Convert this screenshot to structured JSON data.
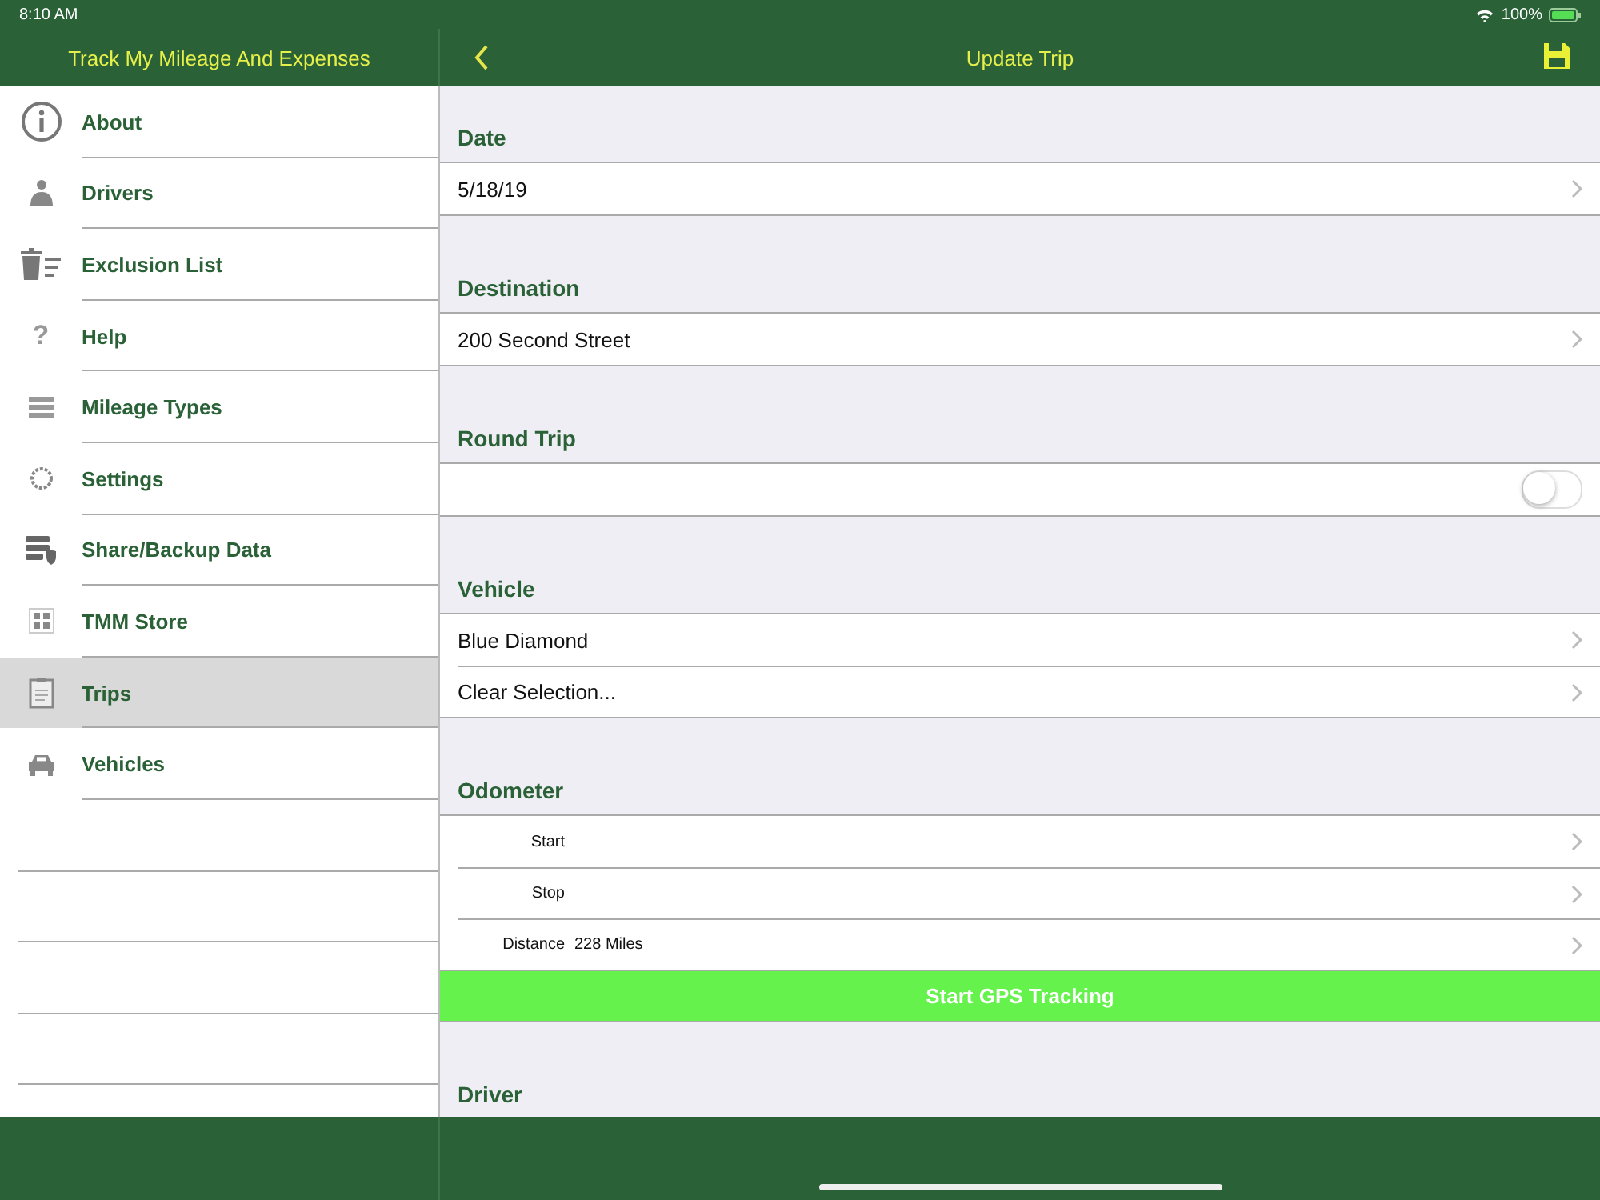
{
  "status_bar": {
    "time": "8:10 AM",
    "battery": "100%"
  },
  "sidebar": {
    "title": "Track My Mileage And Expenses",
    "items": [
      {
        "label": "About",
        "selected": false
      },
      {
        "label": "Drivers",
        "selected": false
      },
      {
        "label": "Exclusion List",
        "selected": false
      },
      {
        "label": "Help",
        "glyph": "?",
        "selected": false
      },
      {
        "label": "Mileage Types",
        "selected": false
      },
      {
        "label": "Settings",
        "selected": false
      },
      {
        "label": "Share/Backup Data",
        "selected": false
      },
      {
        "label": "TMM Store",
        "selected": false
      },
      {
        "label": "Trips",
        "selected": true
      },
      {
        "label": "Vehicles",
        "selected": false
      }
    ]
  },
  "nav": {
    "title": "Update Trip"
  },
  "sections": [
    {
      "title": "Date",
      "items": [
        {
          "kind": "link",
          "text": "5/18/19"
        }
      ]
    },
    {
      "title": "Destination",
      "items": [
        {
          "kind": "link",
          "text": "200 Second Street"
        }
      ]
    },
    {
      "title": "Round Trip",
      "items": [
        {
          "kind": "toggle",
          "on": false
        }
      ]
    },
    {
      "title": "Vehicle",
      "items": [
        {
          "kind": "link",
          "text": "Blue Diamond"
        },
        {
          "kind": "link",
          "text": "Clear Selection..."
        }
      ]
    },
    {
      "title": "Odometer",
      "items": [
        {
          "kind": "field",
          "label": "Start"
        },
        {
          "kind": "field",
          "label": "Stop"
        },
        {
          "kind": "field",
          "label": "Distance",
          "value": "228 Miles"
        },
        {
          "kind": "button",
          "text": "Start GPS Tracking"
        }
      ]
    },
    {
      "title": "Driver"
    }
  ]
}
